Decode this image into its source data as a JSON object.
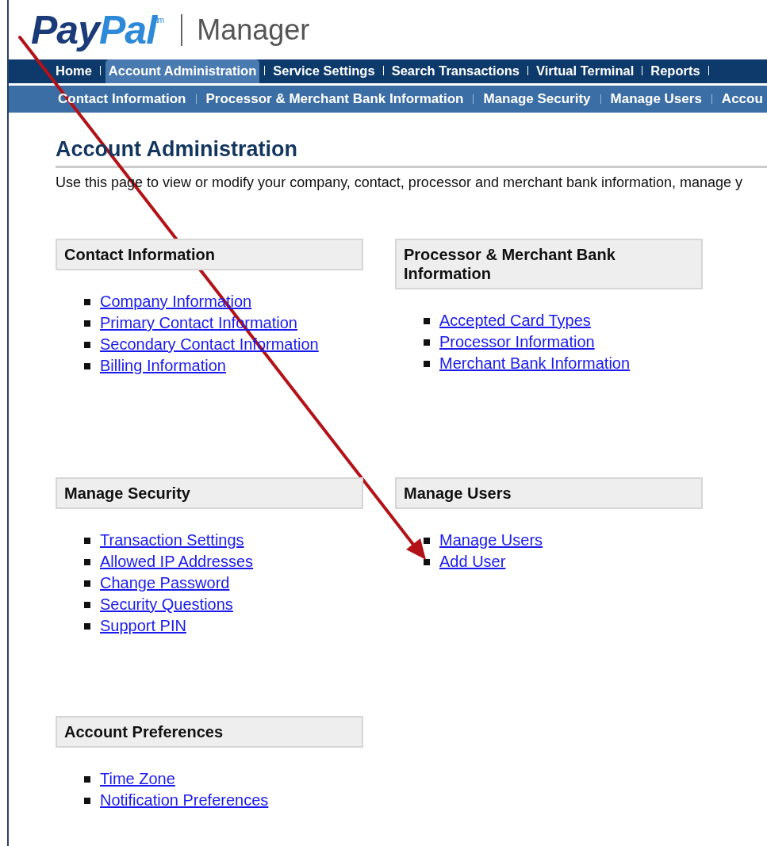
{
  "logo": {
    "parts": [
      "Pay",
      "Pal"
    ],
    "mark": "tm",
    "product": "Manager"
  },
  "nav": [
    {
      "label": "Home",
      "selected": false
    },
    {
      "label": "Account Administration",
      "selected": true
    },
    {
      "label": "Service Settings",
      "selected": false
    },
    {
      "label": "Search Transactions",
      "selected": false
    },
    {
      "label": "Virtual Terminal",
      "selected": false
    },
    {
      "label": "Reports",
      "selected": false
    }
  ],
  "subnav": [
    "Contact Information",
    "Processor & Merchant Bank Information",
    "Manage Security",
    "Manage Users",
    "Accou"
  ],
  "page": {
    "title": "Account Administration",
    "description": "Use this page to view or modify your company, contact, processor and merchant bank information, manage y"
  },
  "sections": [
    {
      "title": "Contact Information",
      "links": [
        "Company Information",
        "Primary Contact Information",
        "Secondary Contact Information",
        "Billing Information"
      ]
    },
    {
      "title": "Processor & Merchant Bank Information",
      "links": [
        "Accepted Card Types",
        "Processor Information",
        "Merchant Bank Information"
      ]
    },
    {
      "title": "Manage Security",
      "links": [
        "Transaction Settings",
        "Allowed IP Addresses",
        "Change Password",
        "Security Questions",
        "Support PIN"
      ]
    },
    {
      "title": "Manage Users",
      "links": [
        "Manage Users",
        "Add User"
      ]
    },
    {
      "title": "Account Preferences",
      "links": [
        "Time Zone",
        "Notification Preferences"
      ]
    }
  ]
}
